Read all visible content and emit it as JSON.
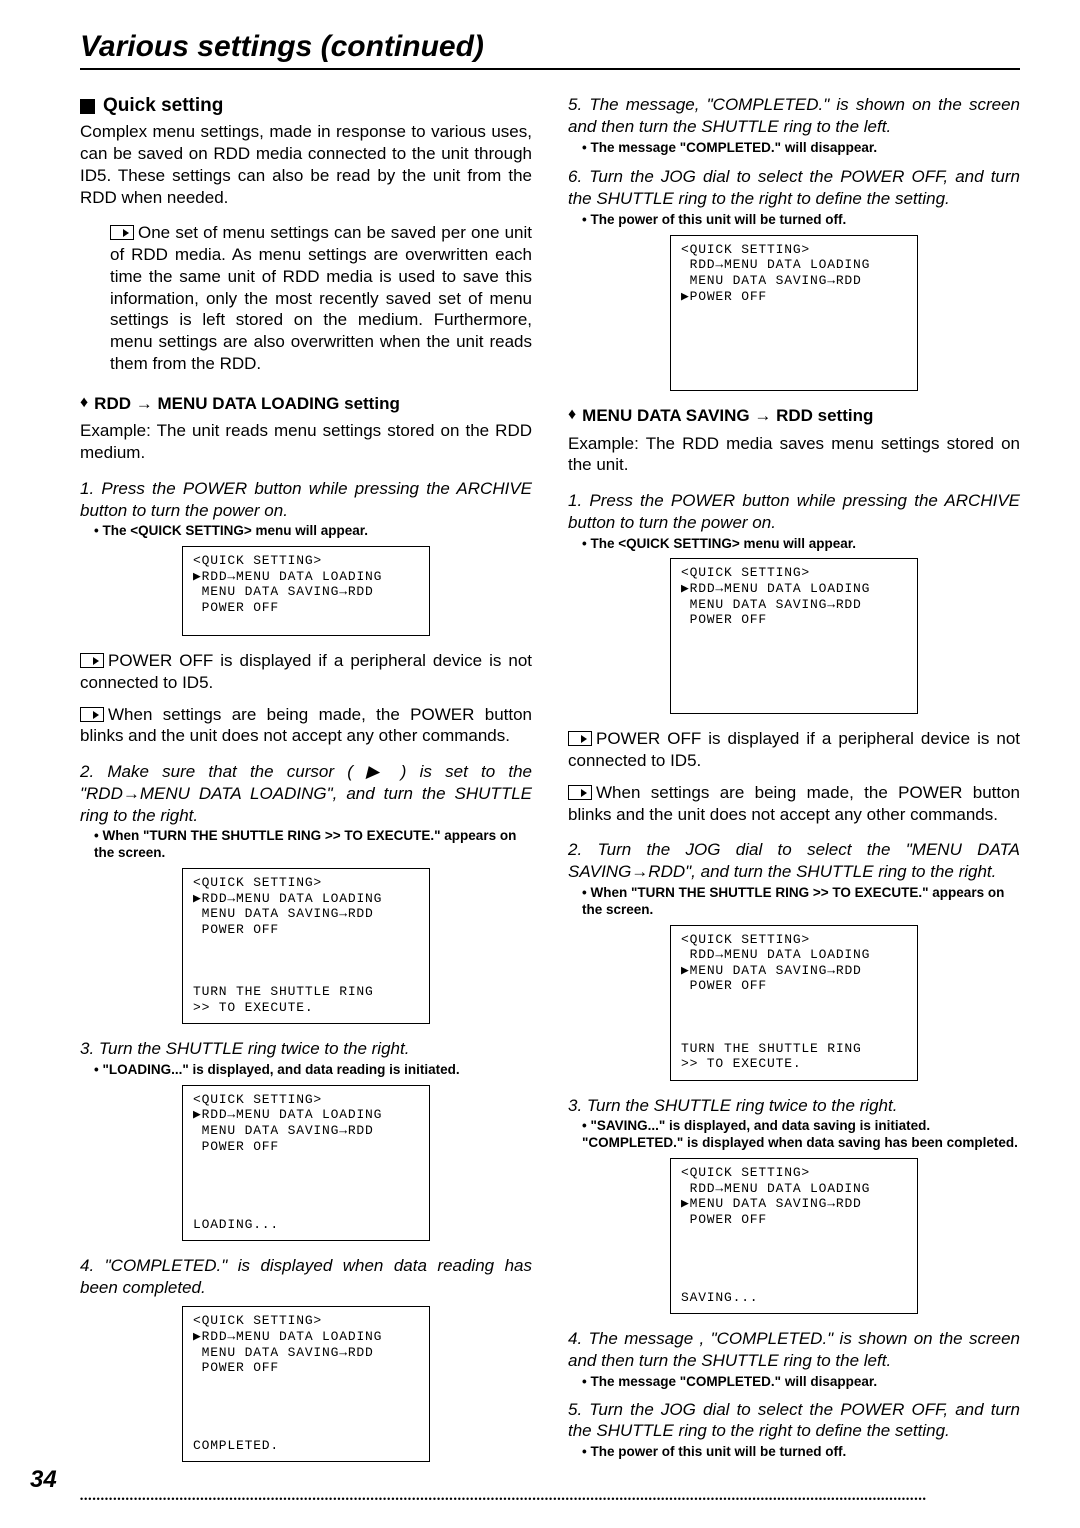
{
  "pageTitle": "Various settings (continued)",
  "pageNumber": "34",
  "left": {
    "quickSettingLabel": "Quick setting",
    "quickSettingBody": "Complex menu settings, made in response to various uses, can be saved on RDD media connected to the unit through ID5. These settings can also be read by the unit from the RDD when needed.",
    "quickNote": "One set of menu settings can be saved per one unit of RDD media. As menu settings are overwritten each time the same unit of RDD media is used to save this information, only the most recently saved set of menu settings is left stored on the medium. Furthermore, menu settings are also overwritten when the unit reads them from the RDD.",
    "rddLoadingHeading": "RDD → MENU DATA LOADING setting",
    "rddLoadingExample": "Example: The unit reads menu settings stored on the RDD medium.",
    "step1": "1. Press the POWER button while pressing the ARCHIVE button to turn the  power on.",
    "step1bullet": "• The <QUICK SETTING> menu will appear.",
    "screen1": "<QUICK SETTING>\n▶RDD→MENU DATA LOADING\n MENU DATA SAVING→RDD\n POWER OFF",
    "postScreen1a": "POWER OFF is displayed if a peripheral device is not connected to ID5.",
    "postScreen1b": "When settings are being made, the POWER button blinks and the unit does not accept any other commands.",
    "step2": "2. Make sure that the cursor ( ▶ ) is set to the  \"RDD→MENU DATA LOADING\", and turn the SHUTTLE ring to the right.",
    "step2bullet": "• When \"TURN THE SHUTTLE RING >> TO EXECUTE.\" appears on the screen.",
    "screen2": "<QUICK SETTING>\n▶RDD→MENU DATA LOADING\n MENU DATA SAVING→RDD\n POWER OFF\n\n\n\nTURN THE SHUTTLE RING\n>> TO EXECUTE.",
    "step3": "3. Turn the SHUTTLE ring twice to the right.",
    "step3bullet": "• \"LOADING...\" is displayed, and data reading is initiated.",
    "screen3": "<QUICK SETTING>\n▶RDD→MENU DATA LOADING\n MENU DATA SAVING→RDD\n POWER OFF\n\n\n\n\nLOADING...",
    "step4": "4. \"COMPLETED.\" is displayed when data reading has been completed.",
    "screen4": "<QUICK SETTING>\n▶RDD→MENU DATA LOADING\n MENU DATA SAVING→RDD\n POWER OFF\n\n\n\n\nCOMPLETED."
  },
  "right": {
    "step5": "5. The message, \"COMPLETED.\" is  shown on the screen and then turn the SHUTTLE ring to the left.",
    "step5bullet": "• The message \"COMPLETED.\" will disappear.",
    "step6": "6. Turn the JOG dial to select the POWER OFF, and turn the SHUTTLE ring to the right to define the setting.",
    "step6bullet": "• The power of this unit will be turned off.",
    "screen5": "<QUICK SETTING>\n RDD→MENU DATA LOADING\n MENU DATA SAVING→RDD\n▶POWER OFF",
    "savingHeading": "MENU DATA SAVING → RDD setting",
    "savingExample": "Example: The RDD media saves menu settings stored on the unit.",
    "sstep1": "1. Press the POWER button while pressing the ARCHIVE button to turn the power on.",
    "sstep1bullet": "• The <QUICK SETTING> menu will appear.",
    "sscreen1": "<QUICK SETTING>\n▶RDD→MENU DATA LOADING\n MENU DATA SAVING→RDD\n POWER OFF",
    "spostScreen1a": "POWER OFF is displayed if a peripheral device is not connected to ID5.",
    "spostScreen1b": "When settings are being made, the POWER button blinks and the unit does not accept any other commands.",
    "sstep2": "2. Turn the JOG dial to select the \"MENU DATA SAVING→RDD\", and turn the SHUTTLE ring to the right.",
    "sstep2bullet": "• When \"TURN THE SHUTTLE RING >> TO EXECUTE.\" appears on the screen.",
    "sscreen2": "<QUICK SETTING>\n RDD→MENU DATA LOADING\n▶MENU DATA SAVING→RDD\n POWER OFF\n\n\n\nTURN THE SHUTTLE RING\n>> TO EXECUTE.",
    "sstep3": "3. Turn the SHUTTLE ring twice to the right.",
    "sstep3bullet": "• \"SAVING...\" is displayed, and data saving is initiated. \"COMPLETED.\" is displayed when data saving has been completed.",
    "sscreen3": "<QUICK SETTING>\n RDD→MENU DATA LOADING\n▶MENU DATA SAVING→RDD\n POWER OFF\n\n\n\n\nSAVING...",
    "sstep4": "4. The message , \"COMPLETED.\" is shown on the screen and then turn the SHUTTLE ring to the left.",
    "sstep4bullet": "• The message \"COMPLETED.\" will disappear.",
    "sstep5": "5. Turn the JOG dial to select the POWER OFF, and turn the SHUTTLE ring to the right to define the setting.",
    "sstep5bullet": "• The power of this unit will be turned off."
  },
  "dots": "••••••••••••••••••••••••••••••••••••••••••••••••••••••••••••••••••••••••••••••••••••••••••••••••••••••••••••••••••••••••••••••••••••••••••••••••••••••••••••••••••••••••••••••••••••••••••••••••••••••••••••"
}
